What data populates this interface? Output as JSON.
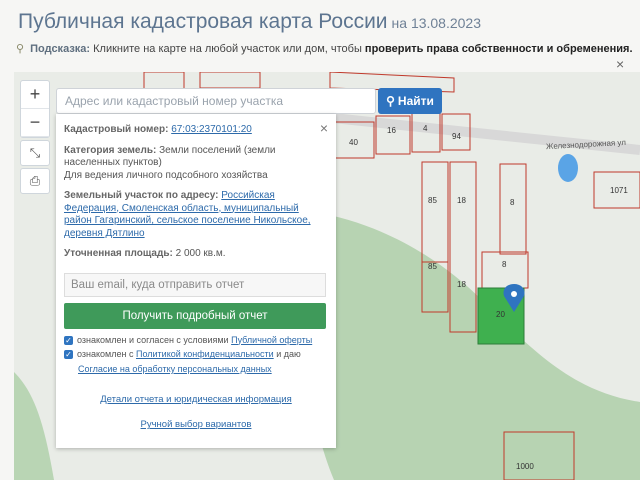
{
  "header": {
    "title": "Публичная кадастровая карта России",
    "date": "на 13.08.2023"
  },
  "hint": {
    "label": "Подсказка:",
    "text": "Кликните на карте на любой участок или дом, чтобы",
    "strong": "проверить права собственности и обременения."
  },
  "search": {
    "placeholder": "Адрес или кадастровый номер участка",
    "button_label": "Найти"
  },
  "panel": {
    "cadastral_label": "Кадастровый номер:",
    "cadastral_value": "67:03:2370101:20",
    "category_label": "Категория земель:",
    "category_value": "Земли поселений (земли населенных пунктов)",
    "usage_value": "Для ведения личного подсобного хозяйства",
    "address_label": "Земельный участок по адресу:",
    "address_value": "Российская Федерация, Смоленская область, муниципальный район Гагаринский, сельское поселение Никольское, деревня Дятлино",
    "area_label": "Уточненная площадь:",
    "area_value": "2 000 кв.м.",
    "email_placeholder": "Ваш email, куда отправить отчет",
    "report_button": "Получить подробный отчет",
    "offer_text": "ознакомлен и согласен с условиями",
    "offer_link": "Публичной оферты",
    "privacy_text": "ознакомлен с",
    "privacy_link": "Политикой конфиденциальности",
    "privacy_tail": "и даю",
    "consent_link": "Согласие на обработку персональных данных",
    "details_link": "Детали отчета и юридическая информация",
    "manual_link": "Ручной выбор вариантов"
  },
  "map": {
    "road_label": "Железнодорожная ул",
    "plots": [
      "40",
      "16",
      "4",
      "94",
      "85",
      "18",
      "8",
      "85",
      "8",
      "18",
      "20",
      "1071",
      "1000"
    ]
  },
  "colors": {
    "accent": "#2f74c0",
    "green_button": "#3f9a5a",
    "selected_plot": "#3fb04f",
    "plot_border": "#c0392b"
  }
}
